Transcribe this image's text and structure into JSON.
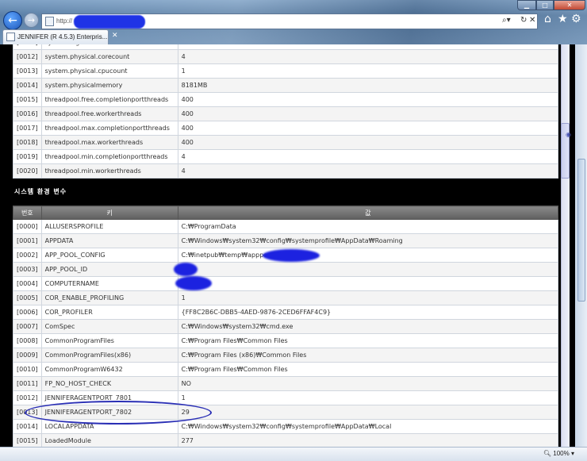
{
  "browser": {
    "url": "http://                 0/main.jsp",
    "tab_title": "JENNIFER (R 4.5.3) Enterpris...",
    "tab_close": "✕",
    "zoom": "100%"
  },
  "top_table": {
    "rows": [
      {
        "id": "[0011]",
        "key": "system.logical.threadcount",
        "value": "4"
      },
      {
        "id": "[0012]",
        "key": "system.physical.corecount",
        "value": "4"
      },
      {
        "id": "[0013]",
        "key": "system.physical.cpucount",
        "value": "1"
      },
      {
        "id": "[0014]",
        "key": "system.physicalmemory",
        "value": "8181MB"
      },
      {
        "id": "[0015]",
        "key": "threadpool.free.completionportthreads",
        "value": "400"
      },
      {
        "id": "[0016]",
        "key": "threadpool.free.workerthreads",
        "value": "400"
      },
      {
        "id": "[0017]",
        "key": "threadpool.max.completionportthreads",
        "value": "400"
      },
      {
        "id": "[0018]",
        "key": "threadpool.max.workerthreads",
        "value": "400"
      },
      {
        "id": "[0019]",
        "key": "threadpool.min.completionportthreads",
        "value": "4"
      },
      {
        "id": "[0020]",
        "key": "threadpool.min.workerthreads",
        "value": "4"
      }
    ]
  },
  "env_section": {
    "title": "시스템 환경 변수",
    "headers": [
      "번호",
      "키",
      "값"
    ],
    "rows": [
      {
        "id": "[0000]",
        "key": "ALLUSERSPROFILE",
        "value": "C:₩ProgramData"
      },
      {
        "id": "[0001]",
        "key": "APPDATA",
        "value": "C:₩Windows₩system32₩config₩systemprofile₩AppData₩Roaming"
      },
      {
        "id": "[0002]",
        "key": "APP_POOL_CONFIG",
        "value": "C:₩inetpub₩temp₩apppools₩                    config"
      },
      {
        "id": "[0003]",
        "key": "APP_POOL_ID",
        "value": ""
      },
      {
        "id": "[0004]",
        "key": "COMPUTERNAME",
        "value": ""
      },
      {
        "id": "[0005]",
        "key": "COR_ENABLE_PROFILING",
        "value": "1"
      },
      {
        "id": "[0006]",
        "key": "COR_PROFILER",
        "value": "{FF8C2B6C-DBB5-4AED-9876-2CED6FFAF4C9}"
      },
      {
        "id": "[0007]",
        "key": "ComSpec",
        "value": "C:₩Windows₩system32₩cmd.exe"
      },
      {
        "id": "[0008]",
        "key": "CommonProgramFiles",
        "value": "C:₩Program Files₩Common Files"
      },
      {
        "id": "[0009]",
        "key": "CommonProgramFiles(x86)",
        "value": "C:₩Program Files (x86)₩Common Files"
      },
      {
        "id": "[0010]",
        "key": "CommonProgramW6432",
        "value": "C:₩Program Files₩Common Files"
      },
      {
        "id": "[0011]",
        "key": "FP_NO_HOST_CHECK",
        "value": "NO"
      },
      {
        "id": "[0012]",
        "key": "JENNIFERAGENTPORT_7801",
        "value": "1"
      },
      {
        "id": "[0013]",
        "key": "JENNIFERAGENTPORT_7802",
        "value": "29"
      },
      {
        "id": "[0014]",
        "key": "LOCALAPPDATA",
        "value": "C:₩Windows₩system32₩config₩systemprofile₩AppData₩Local"
      },
      {
        "id": "[0015]",
        "key": "LoadedModule",
        "value": "277"
      }
    ]
  },
  "colors": {
    "redaction": "#1c22e0",
    "highlight": "#2a2fb5",
    "header_bg": "#6f6f6f"
  },
  "icons": [
    "back-arrow-icon",
    "forward-arrow-icon",
    "page-icon",
    "search-icon",
    "refresh-icon",
    "stop-icon",
    "home-icon",
    "favorites-star-icon",
    "tools-gear-icon",
    "zoom-icon"
  ]
}
